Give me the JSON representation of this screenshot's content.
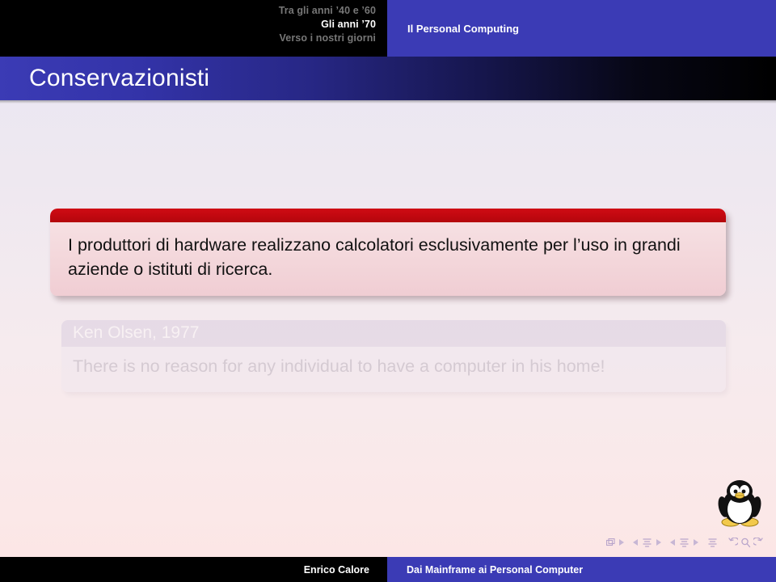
{
  "header": {
    "sections": [
      {
        "label": "Tra gli anni ’40 e ’60",
        "active": false
      },
      {
        "label": "Gli anni ’70",
        "active": true
      },
      {
        "label": "Verso i nostri giorni",
        "active": false
      }
    ],
    "subsection": "Il Personal Computing"
  },
  "title": "Conservazionisti",
  "alert_block": {
    "body": "I produttori di hardware realizzano calcolatori esclusivamente per l’uso in grandi aziende o istituti di ricerca."
  },
  "quote_block": {
    "heading": "Ken Olsen, 1977",
    "body": "There is no reason for any individual to have a computer in his home!"
  },
  "logo": {
    "name": "tux-penguin-logo"
  },
  "nav_symbols": [
    "slide-icon",
    "next-slide-icon",
    "prev-frame-icon",
    "frame-icon",
    "next-frame-icon",
    "prev-subsection-icon",
    "subsection-icon",
    "next-subsection-icon",
    "section-icon",
    "back-icon",
    "search-icon",
    "forward-icon"
  ],
  "footer": {
    "author": "Enrico Calore",
    "talk_title": "Dai Mainframe ai Personal Computer"
  },
  "colors": {
    "structure_blue": "#3b3bb5",
    "alert_red": "#c30810",
    "black": "#000000",
    "white": "#ffffff"
  }
}
